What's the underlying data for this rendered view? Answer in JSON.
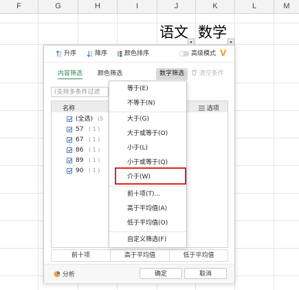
{
  "spreadsheet": {
    "columns": [
      "F",
      "G",
      "H",
      "I",
      "J",
      "K",
      "L",
      "M"
    ],
    "header_cells": {
      "chinese": "语文",
      "math": "数学"
    }
  },
  "toolbar": {
    "sort_asc": "升序",
    "sort_desc": "降序",
    "sort_color": "颜色排序",
    "advanced_mode": "高级模式",
    "accent_color": "#f0a020"
  },
  "tabs": {
    "content_filter": "内容筛选",
    "color_filter": "颜色筛选",
    "number_filter": "数字筛选",
    "clear_conditions": "清空条件",
    "active_color": "#2e8b57"
  },
  "search": {
    "placeholder": "(支持多条件过滤"
  },
  "list": {
    "header_name": "名称",
    "options_label": "选项",
    "items": [
      {
        "label": "(全选)",
        "count": "(5"
      },
      {
        "label": "57",
        "count": "( 1 )"
      },
      {
        "label": "67",
        "count": "( 1 )"
      },
      {
        "label": "86",
        "count": "( 1 )"
      },
      {
        "label": "89",
        "count": "( 1 )"
      },
      {
        "label": "90",
        "count": "( 1 )"
      }
    ]
  },
  "quick": {
    "top_ten": "前十项",
    "above_avg": "高于平均值",
    "below_avg": "低于平均值"
  },
  "footer": {
    "analysis": "分析",
    "ok": "确定",
    "cancel": "取消"
  },
  "menu": {
    "items": [
      "等于(E)",
      "不等于(N)",
      "大于(G)",
      "大于或等于(O)",
      "小于(L)",
      "小于或等于(Q)",
      "介于(W)",
      "前十项(T)...",
      "高于平均值(A)",
      "低于平均值(O)",
      "自定义筛选(F)"
    ],
    "highlight_color": "#e02020"
  }
}
